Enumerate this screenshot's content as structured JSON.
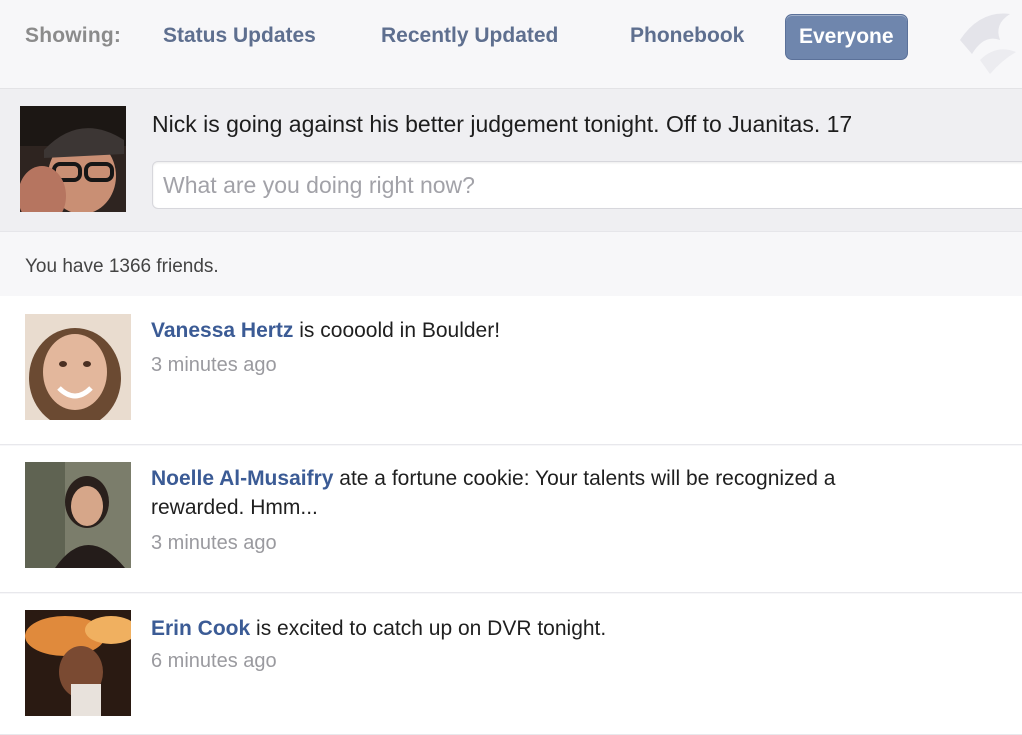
{
  "filters": {
    "label": "Showing:",
    "tabs": [
      {
        "label": "Status Updates"
      },
      {
        "label": "Recently Updated"
      },
      {
        "label": "Phonebook"
      },
      {
        "label": "Everyone",
        "active": true
      }
    ]
  },
  "composer": {
    "current_status": "Nick is going against his better judgement tonight. Off to Juanitas. 17",
    "placeholder": "What are you doing right now?"
  },
  "friend_count_text": "You have 1366 friends.",
  "feed": [
    {
      "name": "Vanessa Hertz",
      "status": "is coooold in Boulder!",
      "time": "3 minutes ago"
    },
    {
      "name": "Noelle Al-Musaifry",
      "status": "ate a fortune cookie: Your talents will be recognized a",
      "status_line2": "rewarded. Hmm...",
      "time": "3 minutes ago"
    },
    {
      "name": "Erin Cook",
      "status": "is excited to catch up on DVR tonight.",
      "time": "6 minutes ago"
    }
  ],
  "colors": {
    "link": "#3b5b95",
    "active_tab_bg": "#6f86ad",
    "muted": "#9a9a9f"
  }
}
